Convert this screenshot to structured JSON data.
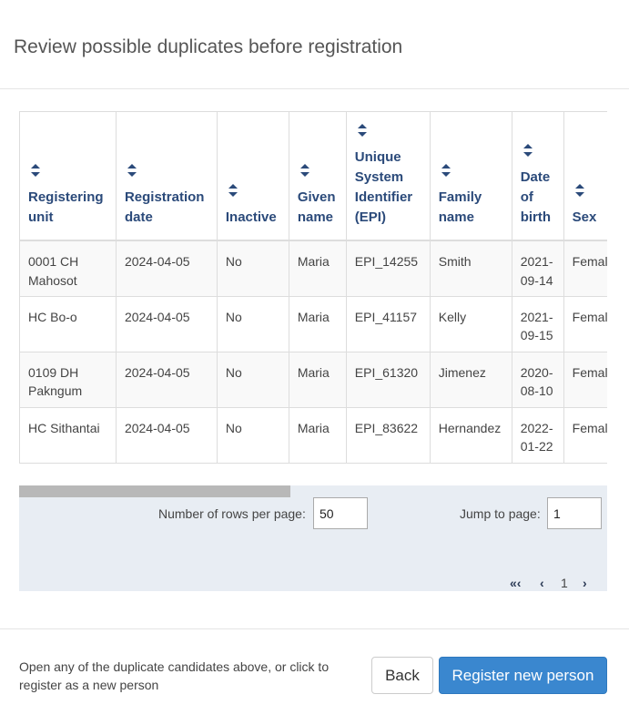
{
  "dialog": {
    "title": "Review possible duplicates before registration"
  },
  "table": {
    "columns": [
      "Registering unit",
      "Registration date",
      "Inactive",
      "Given name",
      "Unique System Identifier (EPI)",
      "Family name",
      "Date of birth",
      "Sex"
    ],
    "rows": [
      [
        "0001 CH Mahosot",
        "2024-04-05",
        "No",
        "Maria",
        "EPI_14255",
        "Smith",
        "2021-09-14",
        "Female"
      ],
      [
        "HC Bo-o",
        "2024-04-05",
        "No",
        "Maria",
        "EPI_41157",
        "Kelly",
        "2021-09-15",
        "Female"
      ],
      [
        "0109 DH Pakngum",
        "2024-04-05",
        "No",
        "Maria",
        "EPI_61320",
        "Jimenez",
        "2020-08-10",
        "Female"
      ],
      [
        "HC Sithantai",
        "2024-04-05",
        "No",
        "Maria",
        "EPI_83622",
        "Hernandez",
        "2022-01-22",
        "Female"
      ]
    ],
    "sort_icon": "sort-arrows-icon"
  },
  "scrollbar": {
    "position": 0.0
  },
  "pager": {
    "rows_per_page_label": "Number of rows per page:",
    "rows_per_page_value": "50",
    "jump_label": "Jump to page:",
    "jump_value": "1",
    "first_label": "«‹",
    "prev_label": "‹",
    "current_page": "1",
    "next_label": "›"
  },
  "footer": {
    "text": "Open any of the duplicate candidates above, or click to register as a new person",
    "back_label": "Back",
    "register_label": "Register new person"
  },
  "colors": {
    "header_text": "#2b4a7a",
    "primary_button": "#3a87cf",
    "pager_background": "#e8edf3"
  }
}
